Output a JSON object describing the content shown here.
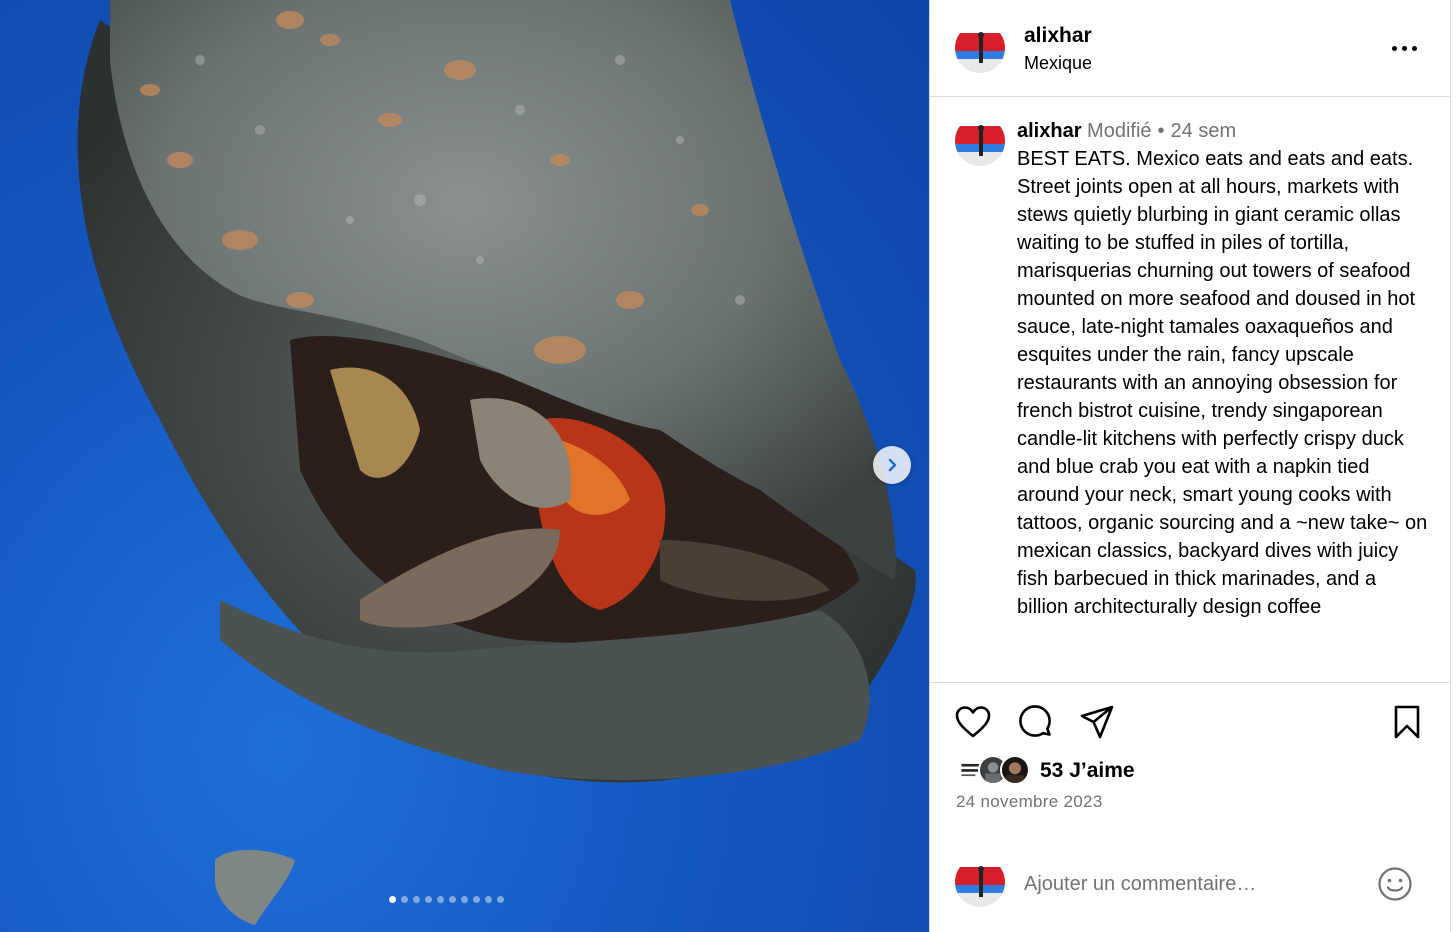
{
  "media": {
    "description_icon": "photo",
    "slide_count": 10,
    "active_slide": 1,
    "next_icon": "chevron-right-icon"
  },
  "post": {
    "username": "alixhar",
    "location": "Mexique",
    "caption": {
      "edited_label": "Modifié",
      "separator": "•",
      "time_ago": "24 sem",
      "text": "BEST EATS. Mexico eats and eats and eats. Street joints open at all hours, markets with stews quietly blurbing in giant ceramic ollas waiting to be stuffed in piles of tortilla, marisquerias churning out towers of seafood mounted on more seafood and doused in hot sauce, late-night tamales oaxaqueños and esquites under the rain, fancy upscale restaurants with an annoying obsession for french bistrot cuisine, trendy singaporean candle-lit kitchens with perfectly crispy duck and blue crab you eat with a napkin tied around your neck, smart young cooks with tattoos, organic sourcing and a ~new take~ on mexican classics, backyard dives with juicy fish barbecued in thick marinades, and a billion architecturally design coffee"
    },
    "likes_label": "53 J’aime",
    "date": "24 novembre 2023",
    "comment_placeholder": "Ajouter un commentaire…"
  },
  "colors": {
    "accent_blue": "#0095f6",
    "muted_text": "#737373",
    "border": "#dbdbdb"
  }
}
